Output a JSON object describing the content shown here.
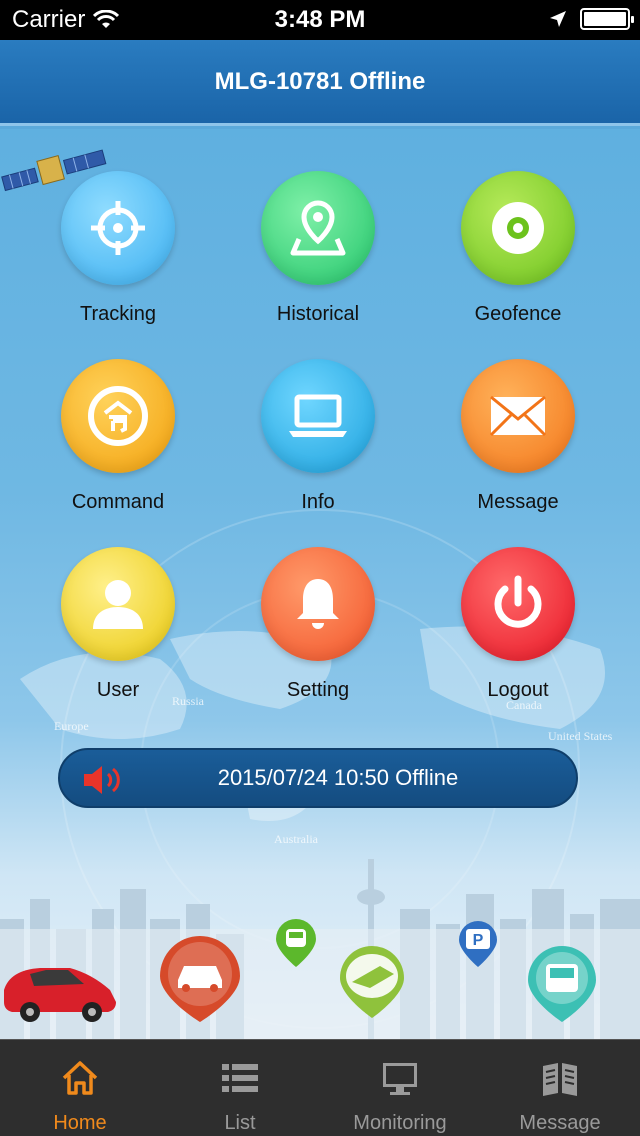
{
  "status_bar": {
    "carrier": "Carrier",
    "time": "3:48 PM"
  },
  "nav": {
    "title": "MLG-10781 Offline"
  },
  "menu": [
    {
      "label": "Tracking",
      "icon": "crosshair-icon",
      "color": "#4ab8f0"
    },
    {
      "label": "Historical",
      "icon": "map-pin-icon",
      "color": "#2fcf7a"
    },
    {
      "label": "Geofence",
      "icon": "target-disc-icon",
      "color": "#7ccb2a"
    },
    {
      "label": "Command",
      "icon": "command-icon",
      "color": "#f3a712"
    },
    {
      "label": "Info",
      "icon": "laptop-icon",
      "color": "#1fa8e0"
    },
    {
      "label": "Message",
      "icon": "envelope-icon",
      "color": "#f47f20"
    },
    {
      "label": "User",
      "icon": "user-icon",
      "color": "#efd21a"
    },
    {
      "label": "Setting",
      "icon": "bell-icon",
      "color": "#f45a35"
    },
    {
      "label": "Logout",
      "icon": "power-icon",
      "color": "#ef2334"
    }
  ],
  "geo_labels": [
    "Russia",
    "Europe",
    "Canada",
    "United States",
    "Australia"
  ],
  "status_pill": {
    "text": "2015/07/24 10:50 Offline"
  },
  "tabs": [
    {
      "label": "Home",
      "icon": "home-icon",
      "active": true
    },
    {
      "label": "List",
      "icon": "list-icon",
      "active": false
    },
    {
      "label": "Monitoring",
      "icon": "monitor-icon",
      "active": false
    },
    {
      "label": "Message",
      "icon": "book-icon",
      "active": false
    }
  ],
  "colors": {
    "accent": "#f08a1c",
    "nav": "#1f6fb4",
    "tabbar": "#2e2e2e"
  }
}
